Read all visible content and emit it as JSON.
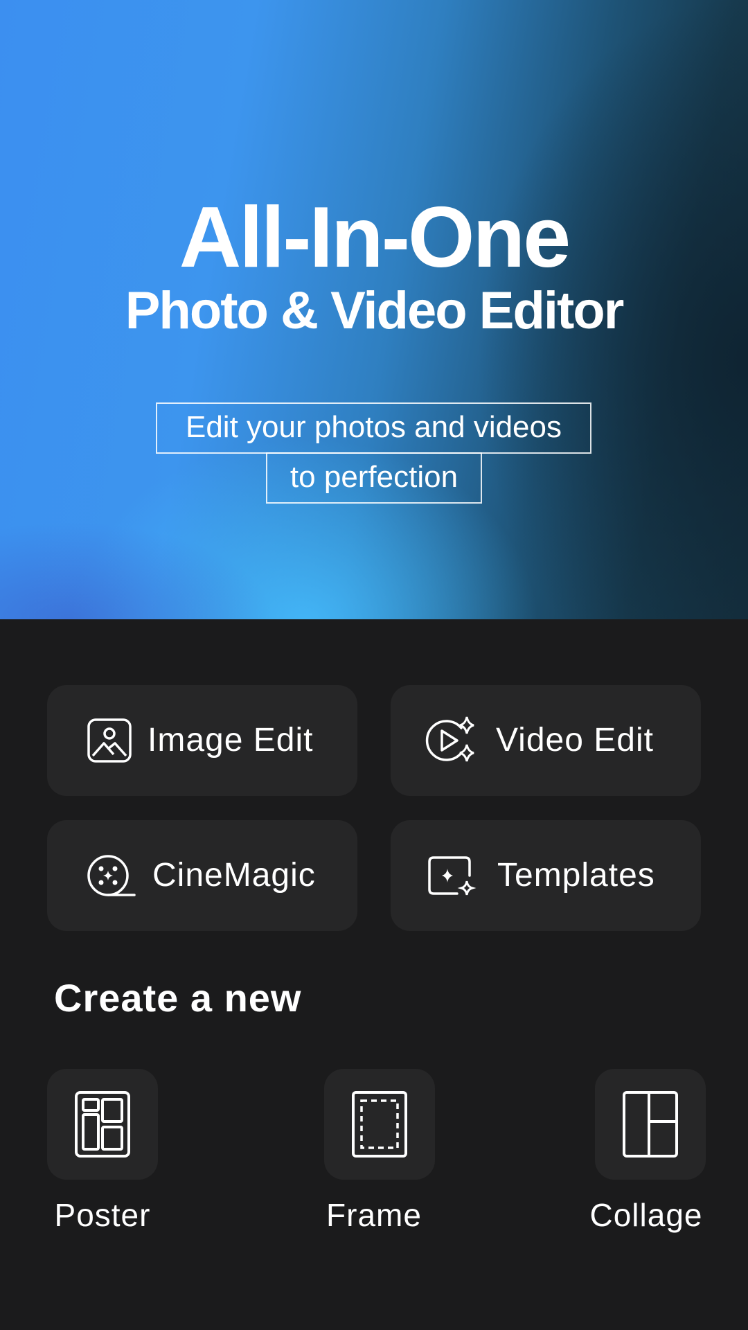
{
  "hero": {
    "title": "All-In-One",
    "subtitle": "Photo & Video Editor",
    "tagline_line1": "Edit your photos and videos",
    "tagline_line2": "to perfection"
  },
  "features": [
    {
      "label": "Image Edit",
      "icon": "image-edit-icon"
    },
    {
      "label": "Video Edit",
      "icon": "video-sparkle-icon"
    },
    {
      "label": "CineMagic",
      "icon": "film-reel-icon"
    },
    {
      "label": "Templates",
      "icon": "template-sparkle-icon"
    }
  ],
  "create": {
    "title": "Create a new",
    "items": [
      {
        "label": "Poster",
        "icon": "poster-layout-icon"
      },
      {
        "label": "Frame",
        "icon": "frame-icon"
      },
      {
        "label": "Collage",
        "icon": "collage-grid-icon"
      }
    ]
  },
  "colors": {
    "background": "#1b1b1c",
    "card": "#262627",
    "hero_blue": "#3c8ff0",
    "hero_dark": "#15303f",
    "text": "#ffffff"
  }
}
